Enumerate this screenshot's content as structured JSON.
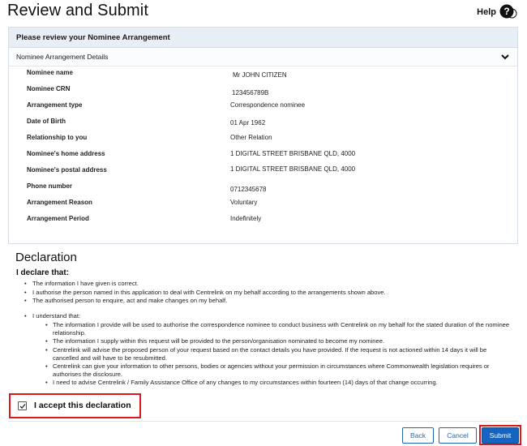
{
  "page": {
    "title": "Review and Submit"
  },
  "help": {
    "label": "Help",
    "icon": "question-icon"
  },
  "nominee_panel": {
    "heading": "Please review your Nominee Arrangement",
    "accordion_label": "Nominee Arrangement Details",
    "rows": [
      {
        "label": "Nominee name",
        "value": "Mr JOHN CITIZEN"
      },
      {
        "label": "Nominee CRN",
        "value": "123456789B"
      },
      {
        "label": "Arrangement type",
        "value": "Correspondence nominee"
      },
      {
        "label": "Date of Birth",
        "value": "01 Apr 1962"
      },
      {
        "label": "Relationship to you",
        "value": "Other Relation"
      },
      {
        "label": "Nominee's home address",
        "value": "1 DIGITAL STREET BRISBANE QLD, 4000"
      },
      {
        "label": "Nominee's postal address",
        "value": "1 DIGITAL STREET BRISBANE QLD, 4000"
      },
      {
        "label": "Phone number",
        "value": "0712345678"
      },
      {
        "label": "Arrangement Reason",
        "value": "Voluntary"
      },
      {
        "label": "Arrangement Period",
        "value": "Indefinitely"
      }
    ]
  },
  "declaration": {
    "title": "Declaration",
    "subtitle": "I declare that:",
    "statements": [
      "The information I have given is correct.",
      "I authorise the person named in this application to deal with Centrelink on my behalf according to the arrangements shown above.",
      "The authorised person to enquire, act and make changes on my behalf."
    ],
    "understand_label": "I understand that:",
    "understand_items": [
      "The information I provide will be used to authorise the correspondence nominee to conduct business with Centrelink on my behalf for the stated duration of the nominee relationship.",
      "The information I supply within this request will be provided to the person/organisation nominated to become my nominee.",
      "Centrelink will advise the proposed person of your request based on the contact details you have provided. If the request is not actioned within 14 days it will be cancelled and will have to be resubmitted.",
      "Centrelink can give your information to other persons, bodies or agencies without your permission in circumstances where Commonwealth legislation requires or authorises the disclosure.",
      "I need to advise Centrelink / Family Assistance Office of any changes to my circumstances within fourteen (14) days of that change occurring."
    ],
    "accept_label": "I accept this declaration",
    "accepted": true
  },
  "actions": {
    "back_label": "Back",
    "cancel_label": "Cancel",
    "submit_label": "Submit"
  },
  "colors": {
    "highlight": "#e0161f",
    "primary": "#1565c0",
    "panel_header": "#e8eef5"
  }
}
